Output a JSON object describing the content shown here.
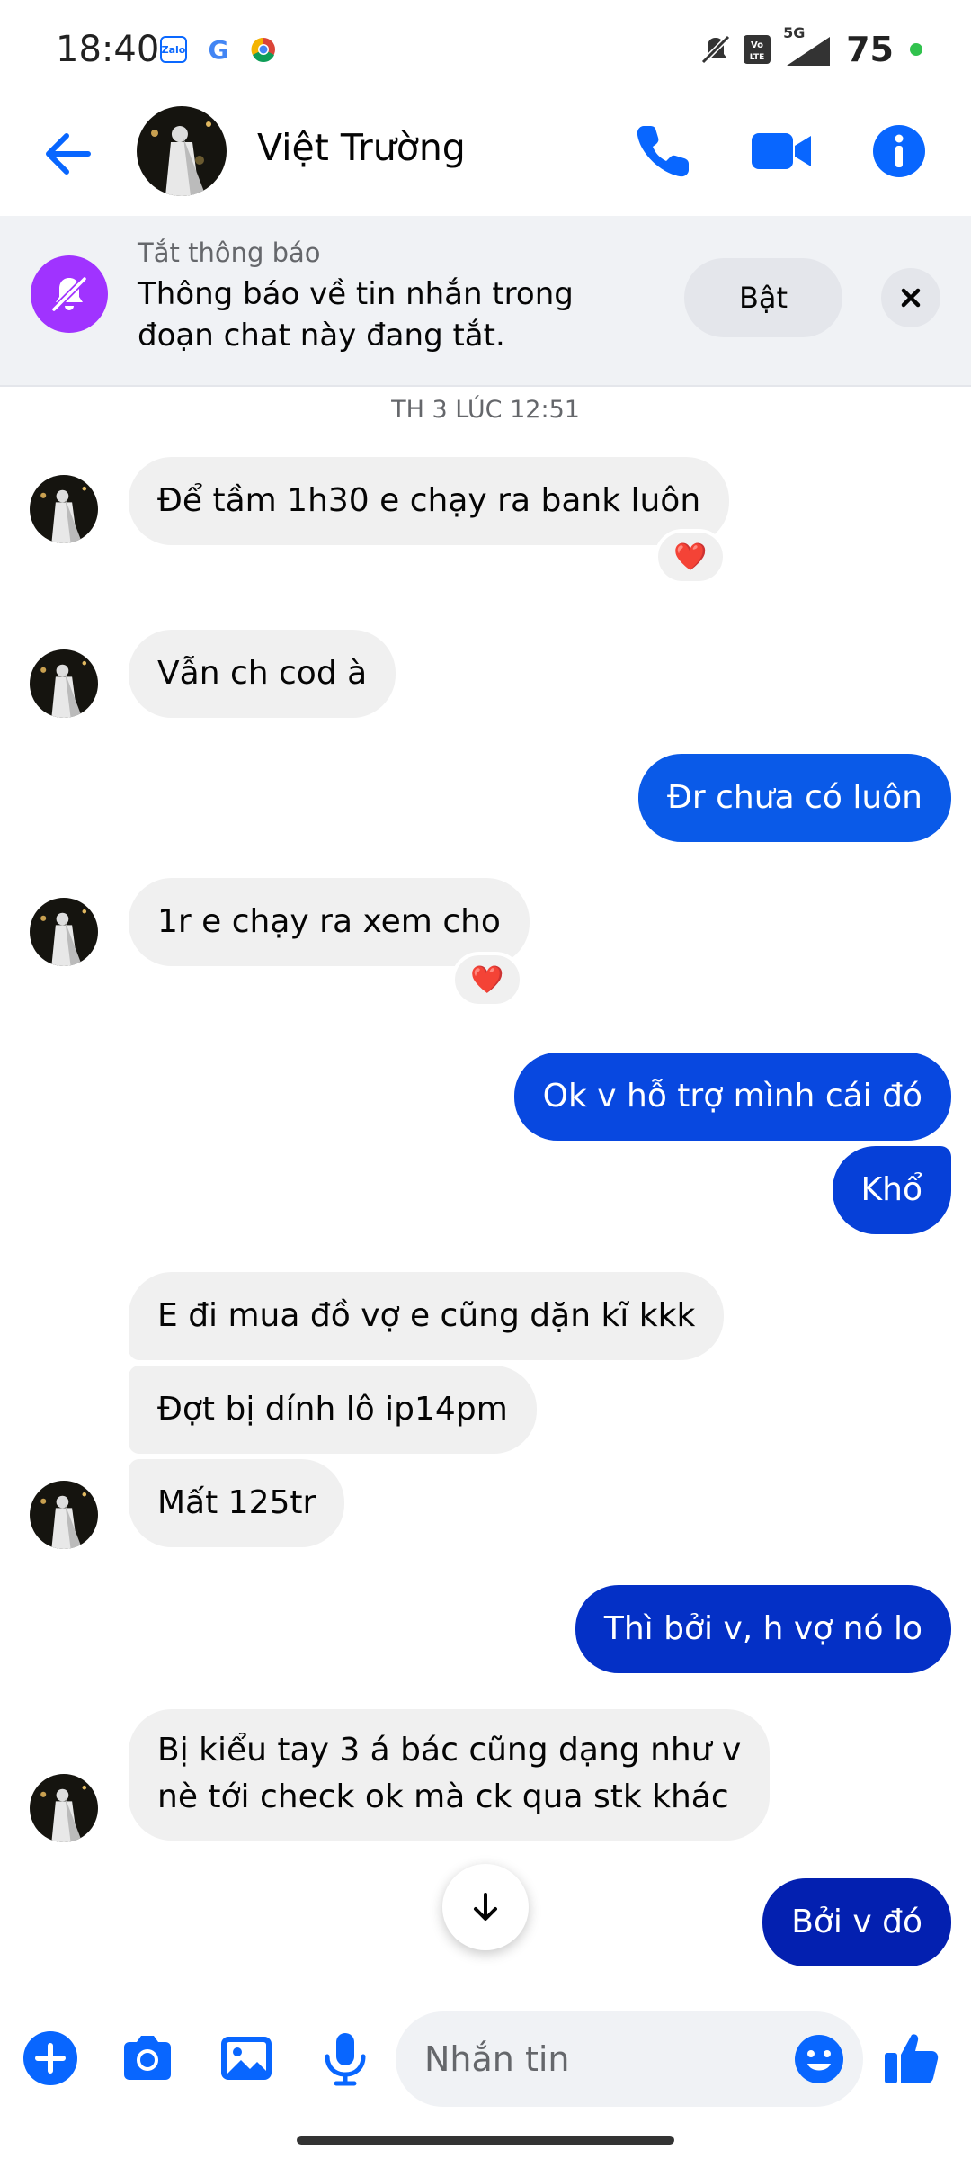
{
  "status_bar": {
    "time": "18:40",
    "apps": [
      "Zalo",
      "G"
    ],
    "battery": "75",
    "network": "5G"
  },
  "header": {
    "contact_name": "Việt Trường"
  },
  "mute_banner": {
    "title": "Tắt thông báo",
    "text": "Thông báo về tin nhắn trong đoạn chat này đang tắt.",
    "button": "Bật"
  },
  "timestamp": "TH 3 LÚC 12:51",
  "messages": [
    {
      "direction": "incoming",
      "text": "Để tầm 1h30 e chạy ra bank luôn",
      "reaction": "❤️"
    },
    {
      "direction": "incoming",
      "text": "Vẫn ch cod à"
    },
    {
      "direction": "outgoing",
      "text": "Đr chưa có luôn"
    },
    {
      "direction": "incoming",
      "text": "1r e chạy ra xem cho",
      "reaction": "❤️"
    },
    {
      "direction": "outgoing",
      "text": "Ok v hỗ trợ mình cái đó"
    },
    {
      "direction": "outgoing",
      "text": "Khổ"
    },
    {
      "direction": "incoming",
      "text": "E đi mua đồ vợ e cũng dặn kĩ kkk"
    },
    {
      "direction": "incoming",
      "text": "Đợt bị dính lô ip14pm"
    },
    {
      "direction": "incoming",
      "text": "Mất 125tr"
    },
    {
      "direction": "outgoing",
      "text": "Thì bởi v, h vợ nó lo"
    },
    {
      "direction": "incoming",
      "text_lines": [
        "Bị kiểu tay 3 á bác cũng dạng như v",
        "nè tới check ok mà ck qua stk khác"
      ]
    },
    {
      "direction": "outgoing",
      "text": "Bởi v đó"
    }
  ],
  "composer": {
    "placeholder": "Nhắn tin"
  },
  "colors": {
    "accent": "#0866ff",
    "outgoing_top": "#0a5ae8",
    "outgoing_bottom": "#0320b0",
    "incoming": "#f0f0f0",
    "mute_icon_bg": "#a033ff"
  },
  "icons": [
    "back-arrow-icon",
    "phone-icon",
    "video-icon",
    "info-icon",
    "bell-off-icon",
    "close-icon",
    "heart-icon",
    "arrow-down-icon",
    "plus-icon",
    "camera-icon",
    "gallery-icon",
    "mic-icon",
    "emoji-icon",
    "thumbs-up-icon"
  ]
}
